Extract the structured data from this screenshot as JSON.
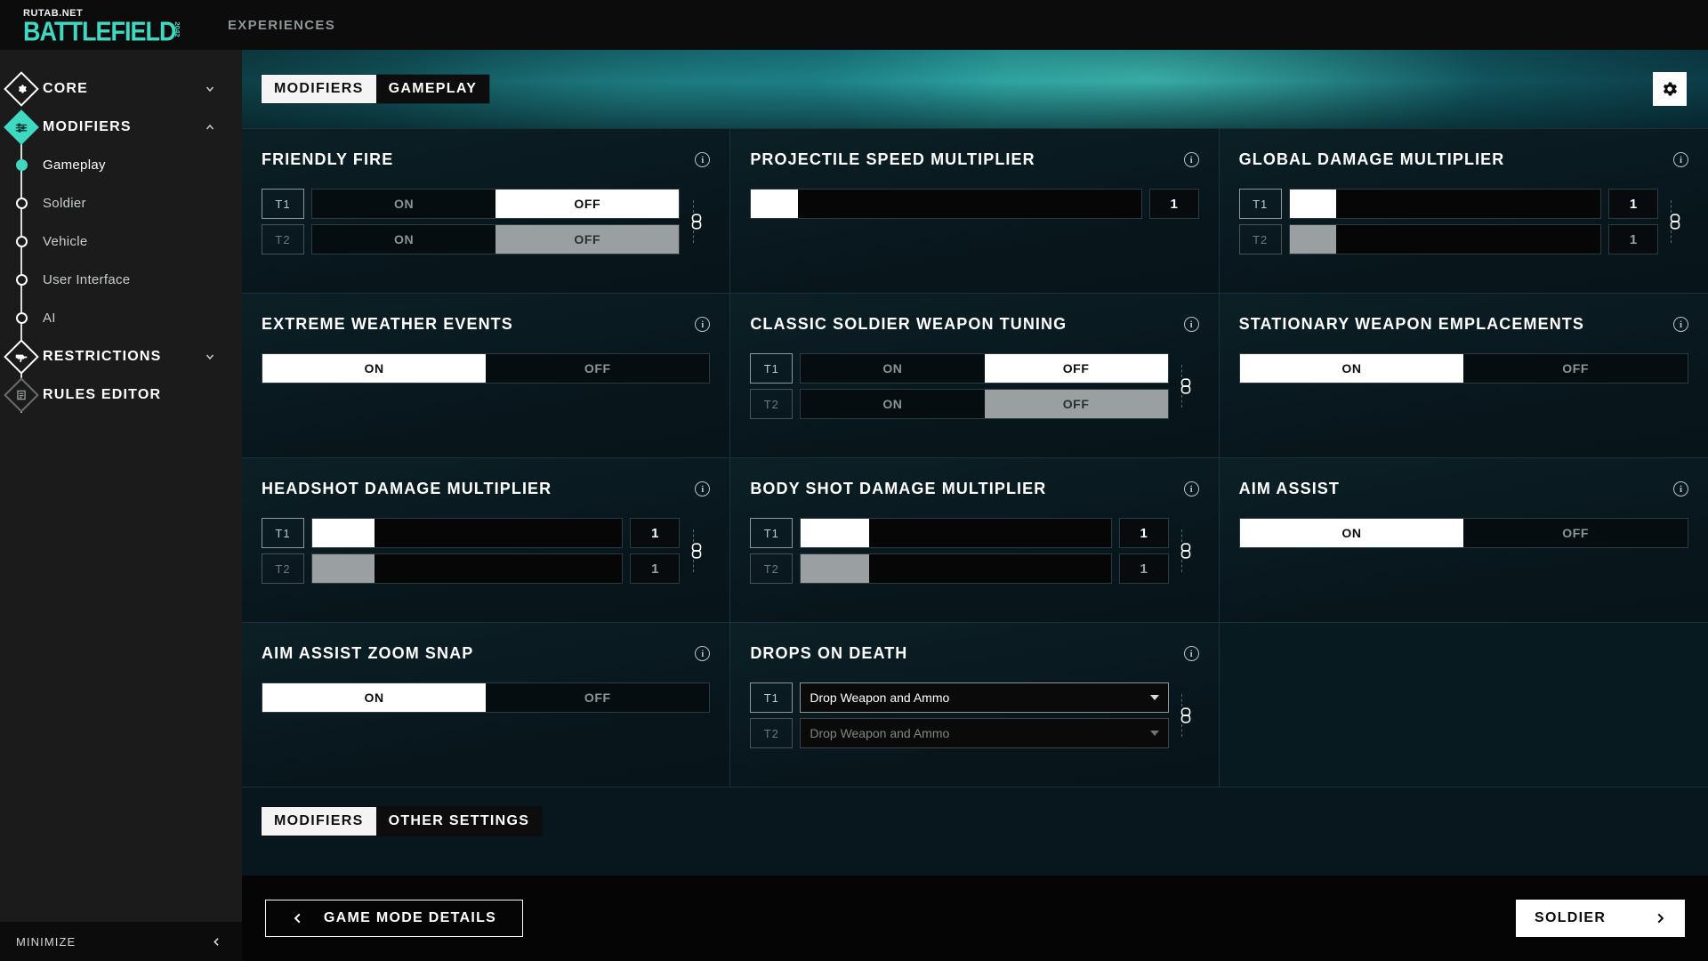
{
  "topbar": {
    "watermark": "RUTAB.NET",
    "logo": "BATTLEFIELD",
    "logo_year": "2042",
    "nav": [
      {
        "label": "EXPERIENCES"
      }
    ]
  },
  "sidebar": {
    "items": [
      {
        "label": "CORE",
        "type": "group",
        "icon": "gear-icon",
        "expanded": false,
        "chevron": "chevron-down-icon"
      },
      {
        "label": "MODIFIERS",
        "type": "group",
        "icon": "sliders-icon",
        "expanded": true,
        "chevron": "chevron-up-icon"
      },
      {
        "label": "Gameplay",
        "type": "sub",
        "icon": "dot-icon",
        "active": true
      },
      {
        "label": "Soldier",
        "type": "sub",
        "icon": "dot-icon",
        "active": false
      },
      {
        "label": "Vehicle",
        "type": "sub",
        "icon": "dot-icon",
        "active": false
      },
      {
        "label": "User Interface",
        "type": "sub",
        "icon": "dot-icon",
        "active": false
      },
      {
        "label": "AI",
        "type": "sub",
        "icon": "dot-icon",
        "active": false
      },
      {
        "label": "RESTRICTIONS",
        "type": "group",
        "icon": "weapon-icon",
        "expanded": false,
        "chevron": "chevron-down-icon"
      },
      {
        "label": "RULES EDITOR",
        "type": "group",
        "icon": "rules-icon",
        "expanded": false,
        "chevron": ""
      }
    ],
    "minimize": {
      "label": "MINIMIZE",
      "icon": "chevron-left-icon"
    }
  },
  "header": {
    "breadcrumb": [
      {
        "label": "MODIFIERS",
        "selected": true
      },
      {
        "label": "GAMEPLAY",
        "selected": false
      }
    ],
    "settings_icon": "gear-icon"
  },
  "cards": [
    {
      "title": "FRIENDLY FIRE",
      "control": "toggle",
      "info_icon": "info-icon",
      "linked": true,
      "rows": [
        {
          "team": "T1",
          "enabled": true,
          "options": [
            "ON",
            "OFF"
          ],
          "selected": "OFF"
        },
        {
          "team": "T2",
          "enabled": false,
          "options": [
            "ON",
            "OFF"
          ],
          "selected": "OFF"
        }
      ]
    },
    {
      "title": "PROJECTILE SPEED MULTIPLIER",
      "control": "slider",
      "info_icon": "info-icon",
      "linked": false,
      "rows": [
        {
          "team": "",
          "enabled": true,
          "value": "1",
          "fill_percent": 12
        }
      ]
    },
    {
      "title": "GLOBAL DAMAGE MULTIPLIER",
      "control": "slider",
      "info_icon": "info-icon",
      "linked": true,
      "rows": [
        {
          "team": "T1",
          "enabled": true,
          "value": "1",
          "fill_percent": 15
        },
        {
          "team": "T2",
          "enabled": false,
          "value": "1",
          "fill_percent": 15
        }
      ]
    },
    {
      "title": "EXTREME WEATHER EVENTS",
      "control": "toggle",
      "info_icon": "info-icon",
      "linked": false,
      "rows": [
        {
          "team": "",
          "enabled": true,
          "options": [
            "ON",
            "OFF"
          ],
          "selected": "ON"
        }
      ]
    },
    {
      "title": "CLASSIC SOLDIER WEAPON TUNING",
      "control": "toggle",
      "info_icon": "info-icon",
      "linked": true,
      "rows": [
        {
          "team": "T1",
          "enabled": true,
          "options": [
            "ON",
            "OFF"
          ],
          "selected": "OFF"
        },
        {
          "team": "T2",
          "enabled": false,
          "options": [
            "ON",
            "OFF"
          ],
          "selected": "OFF"
        }
      ]
    },
    {
      "title": "STATIONARY WEAPON EMPLACEMENTS",
      "control": "toggle",
      "info_icon": "info-icon",
      "linked": false,
      "rows": [
        {
          "team": "",
          "enabled": true,
          "options": [
            "ON",
            "OFF"
          ],
          "selected": "ON"
        }
      ]
    },
    {
      "title": "HEADSHOT DAMAGE MULTIPLIER",
      "control": "slider",
      "info_icon": "info-icon",
      "linked": true,
      "rows": [
        {
          "team": "T1",
          "enabled": true,
          "value": "1",
          "fill_percent": 20
        },
        {
          "team": "T2",
          "enabled": false,
          "value": "1",
          "fill_percent": 20
        }
      ]
    },
    {
      "title": "BODY SHOT DAMAGE MULTIPLIER",
      "control": "slider",
      "info_icon": "info-icon",
      "linked": true,
      "rows": [
        {
          "team": "T1",
          "enabled": true,
          "value": "1",
          "fill_percent": 22
        },
        {
          "team": "T2",
          "enabled": false,
          "value": "1",
          "fill_percent": 22
        }
      ]
    },
    {
      "title": "AIM ASSIST",
      "control": "toggle",
      "info_icon": "info-icon",
      "linked": false,
      "rows": [
        {
          "team": "",
          "enabled": true,
          "options": [
            "ON",
            "OFF"
          ],
          "selected": "ON"
        }
      ]
    },
    {
      "title": "AIM ASSIST ZOOM SNAP",
      "control": "toggle",
      "info_icon": "info-icon",
      "linked": false,
      "rows": [
        {
          "team": "",
          "enabled": true,
          "options": [
            "ON",
            "OFF"
          ],
          "selected": "ON"
        }
      ]
    },
    {
      "title": "DROPS ON DEATH",
      "control": "dropdown",
      "info_icon": "info-icon",
      "linked": true,
      "rows": [
        {
          "team": "T1",
          "enabled": true,
          "value": "Drop Weapon and Ammo"
        },
        {
          "team": "T2",
          "enabled": false,
          "value": "Drop Weapon and Ammo"
        }
      ]
    },
    {
      "title": "",
      "control": "blank",
      "info_icon": "",
      "linked": false,
      "rows": []
    }
  ],
  "bottom_tabs": [
    {
      "label": "MODIFIERS",
      "selected": true
    },
    {
      "label": "OTHER SETTINGS",
      "selected": false
    }
  ],
  "footer": {
    "back": {
      "label": "GAME MODE DETAILS",
      "icon": "chevron-left-icon"
    },
    "next": {
      "label": "SOLDIER",
      "icon": "chevron-right-icon"
    }
  },
  "colors": {
    "accent": "#3fd8c0",
    "hero_teal": "#1f8d92",
    "panel_bg": "#08171d",
    "sidebar_bg": "#1b1b1b"
  }
}
